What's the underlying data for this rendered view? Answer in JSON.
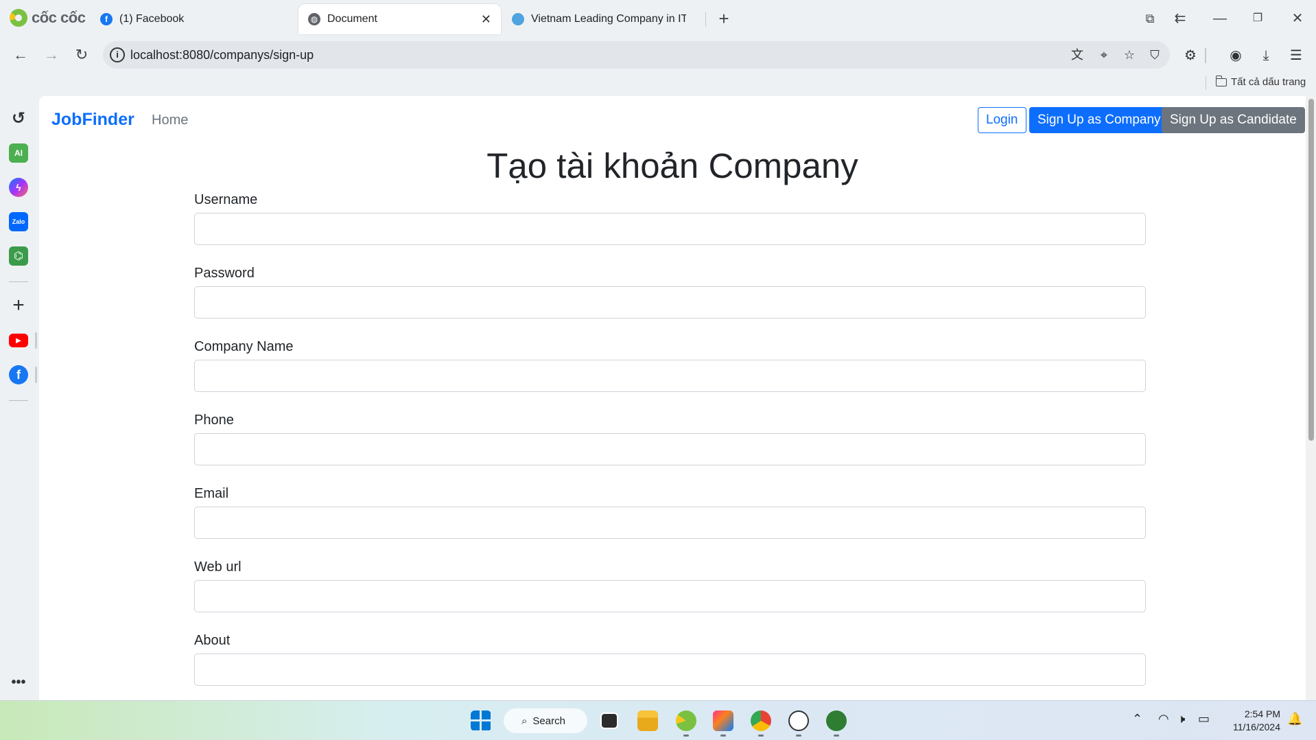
{
  "browser": {
    "brand": "cốc cốc",
    "tabs": [
      {
        "label": "(1) Facebook",
        "icon": "facebook-icon"
      },
      {
        "label": "Document",
        "icon": "globe-icon"
      },
      {
        "label": "Vietnam Leading Company in IT S",
        "icon": "website-icon"
      }
    ],
    "new_tab": "+",
    "url": "localhost:8080/companys/sign-up",
    "bookmarks_all": "Tất cả dấu trang"
  },
  "sidebar": {
    "items": [
      "history-icon",
      "ai-icon",
      "messenger-icon",
      "zalo-icon",
      "game-icon",
      "add-icon",
      "youtube-icon",
      "facebook-icon",
      "more-icon"
    ],
    "ai_label": "AI",
    "zalo_label": "Zalo"
  },
  "app": {
    "brand": "JobFinder",
    "nav_home": "Home",
    "buttons": {
      "login": "Login",
      "signup_company": "Sign Up as Company",
      "signup_candidate": "Sign Up as Candidate"
    },
    "title": "Tạo tài khoản Company",
    "fields": [
      {
        "label": "Username",
        "value": ""
      },
      {
        "label": "Password",
        "value": ""
      },
      {
        "label": "Company Name",
        "value": ""
      },
      {
        "label": "Phone",
        "value": ""
      },
      {
        "label": "Email",
        "value": ""
      },
      {
        "label": "Web url",
        "value": ""
      },
      {
        "label": "About",
        "value": ""
      }
    ]
  },
  "taskbar": {
    "search_label": "Search",
    "time": "2:54 PM",
    "date": "11/16/2024"
  },
  "colors": {
    "primary": "#0d6efd",
    "secondary": "#6c757d",
    "chrome_bg": "#eef1f4"
  }
}
